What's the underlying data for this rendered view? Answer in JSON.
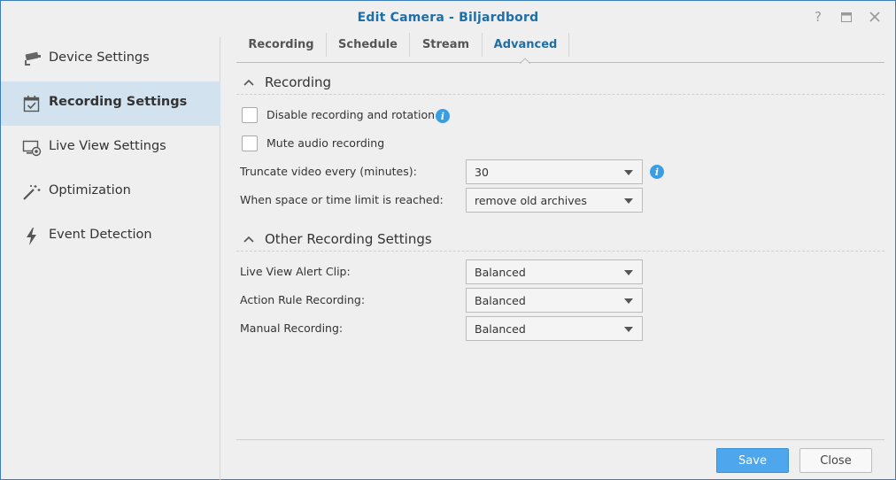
{
  "window": {
    "title": "Edit Camera - Biljardbord",
    "controls": {
      "help": "?",
      "maximize": "☐",
      "close": "✕"
    }
  },
  "sidebar": {
    "items": [
      {
        "label": "Device Settings",
        "icon": "camera-icon"
      },
      {
        "label": "Recording Settings",
        "icon": "calendar-check-icon",
        "active": true
      },
      {
        "label": "Live View Settings",
        "icon": "monitor-icon"
      },
      {
        "label": "Optimization",
        "icon": "magic-wand-icon"
      },
      {
        "label": "Event Detection",
        "icon": "lightning-icon"
      }
    ]
  },
  "tabs": [
    {
      "label": "Recording"
    },
    {
      "label": "Schedule"
    },
    {
      "label": "Stream"
    },
    {
      "label": "Advanced",
      "active": true
    }
  ],
  "recording": {
    "title": "Recording",
    "disable_label": "Disable recording and rotation",
    "disable_checked": false,
    "mute_label": "Mute audio recording",
    "mute_checked": false,
    "truncate_label": "Truncate video every (minutes):",
    "truncate_value": "30",
    "limit_label": "When space or time limit is reached:",
    "limit_value": "remove old archives"
  },
  "other": {
    "title": "Other Recording Settings",
    "alert_label": "Live View Alert Clip:",
    "alert_value": "Balanced",
    "action_label": "Action Rule Recording:",
    "action_value": "Balanced",
    "manual_label": "Manual Recording:",
    "manual_value": "Balanced"
  },
  "footer": {
    "save": "Save",
    "close": "Close"
  },
  "colors": {
    "accent": "#1e6fa8",
    "active_bg": "#d3e2ef",
    "save_bg": "#4ea7ec",
    "info": "#3a9ee4"
  }
}
